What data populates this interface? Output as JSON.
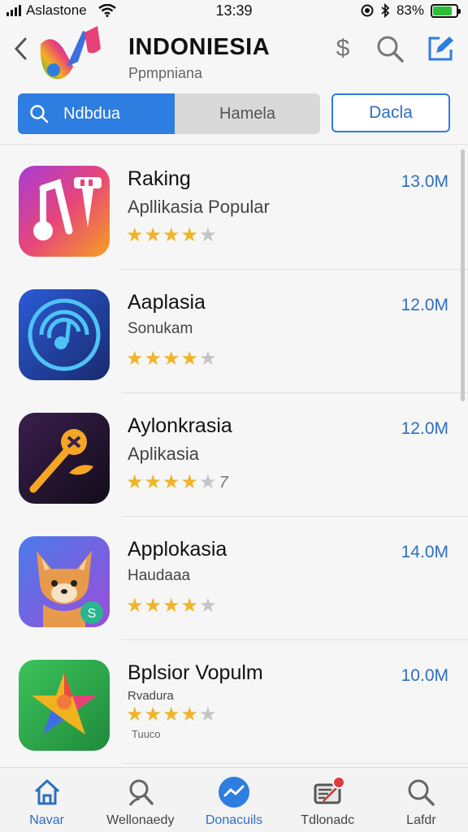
{
  "status_bar": {
    "carrier": "Aslastone",
    "time": "13:39",
    "battery": "83%",
    "battery_level": 0.83
  },
  "header": {
    "title": "INDONIESIA",
    "subtitle": "Ppmpniana",
    "dollar_glyph": "$"
  },
  "segments": [
    {
      "label": "Ndbdua",
      "active": true
    },
    {
      "label": "Hamela",
      "active": false
    }
  ],
  "date_button": "Dacla",
  "apps": [
    {
      "name": "Raking",
      "subtitle": "Apllikasia Popular",
      "size": "13.0M",
      "rating": 4,
      "rating_suffix": "",
      "caption": ""
    },
    {
      "name": "Aaplasia",
      "subtitle": "Sonukam",
      "size": "12.0M",
      "rating": 4,
      "rating_suffix": "",
      "caption": ""
    },
    {
      "name": "Aylonkrasia",
      "subtitle": "Aplikasia",
      "size": "12.0M",
      "rating": 4,
      "rating_suffix": "7",
      "caption": ""
    },
    {
      "name": "Applokasia",
      "subtitle": "Haudaaa",
      "size": "14.0M",
      "rating": 4,
      "rating_suffix": "",
      "caption": ""
    },
    {
      "name": "Bplsior Vopulm",
      "subtitle": "Rvadura",
      "size": "10.0M",
      "rating": 4,
      "rating_suffix": "",
      "caption": "Tuuco"
    }
  ],
  "tabbar": [
    {
      "label": "Navar",
      "icon": "home-icon",
      "active": true
    },
    {
      "label": "Wellonaedy",
      "icon": "person-icon",
      "active": false
    },
    {
      "label": "Donacuils",
      "icon": "trend-icon",
      "active": false
    },
    {
      "label": "Tdlonadc",
      "icon": "inbox-icon",
      "active": false
    },
    {
      "label": "Lafdr",
      "icon": "search-icon",
      "active": false
    }
  ],
  "colors": {
    "accent": "#2e7de0",
    "accent_text": "#2e6fc0",
    "star": "#f0b429",
    "battery": "#2bbf3a",
    "badge": "#e23b3b"
  }
}
